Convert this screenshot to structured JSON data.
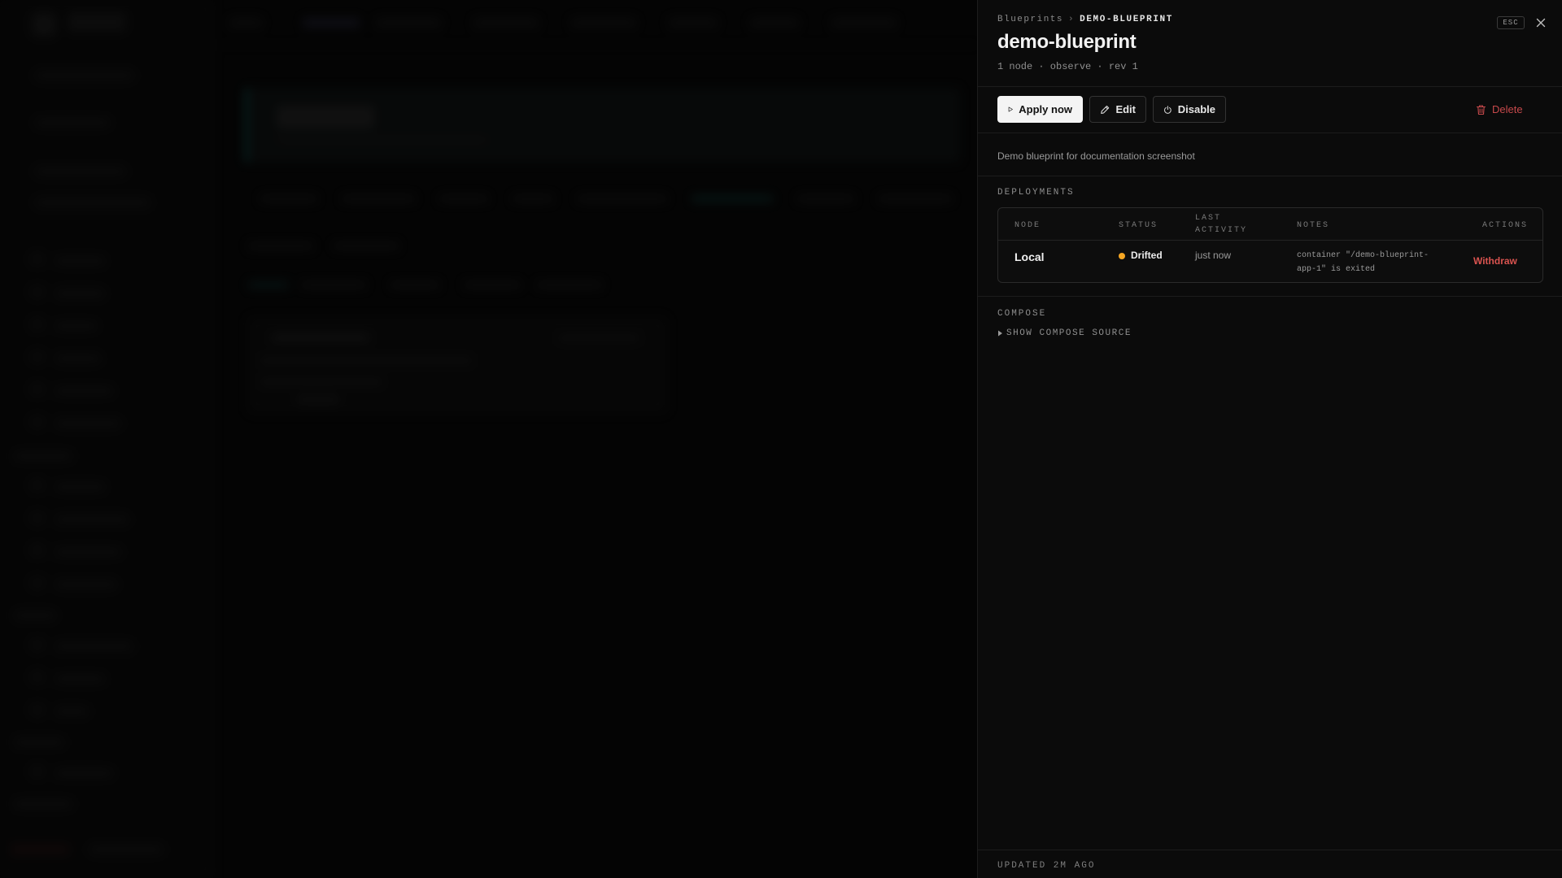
{
  "drawer": {
    "breadcrumb": {
      "parent": "Blueprints",
      "separator": "›",
      "current": "DEMO-BLUEPRINT"
    },
    "title": "demo-blueprint",
    "meta": "1 node · observe · rev 1",
    "esc_label": "ESC",
    "actions": {
      "apply_label": "Apply now",
      "edit_label": "Edit",
      "disable_label": "Disable",
      "delete_label": "Delete"
    },
    "description": "Demo blueprint for documentation screenshot",
    "deployments": {
      "label": "DEPLOYMENTS",
      "columns": {
        "node": "NODE",
        "status": "STATUS",
        "last_activity": "LAST ACTIVITY",
        "notes": "NOTES",
        "actions": "ACTIONS"
      },
      "rows": [
        {
          "node": "Local",
          "status": "Drifted",
          "status_color": "#f5a623",
          "last_activity": "just now",
          "notes": "container \"/demo-blueprint-app-1\" is exited",
          "action": "Withdraw"
        }
      ]
    },
    "compose": {
      "label": "COMPOSE",
      "toggle_label": "SHOW COMPOSE SOURCE"
    },
    "footer": {
      "updated": "UPDATED 2M AGO"
    }
  },
  "colors": {
    "accent": "#19b6b0",
    "danger": "#c6494b",
    "drifted": "#f5a623"
  }
}
